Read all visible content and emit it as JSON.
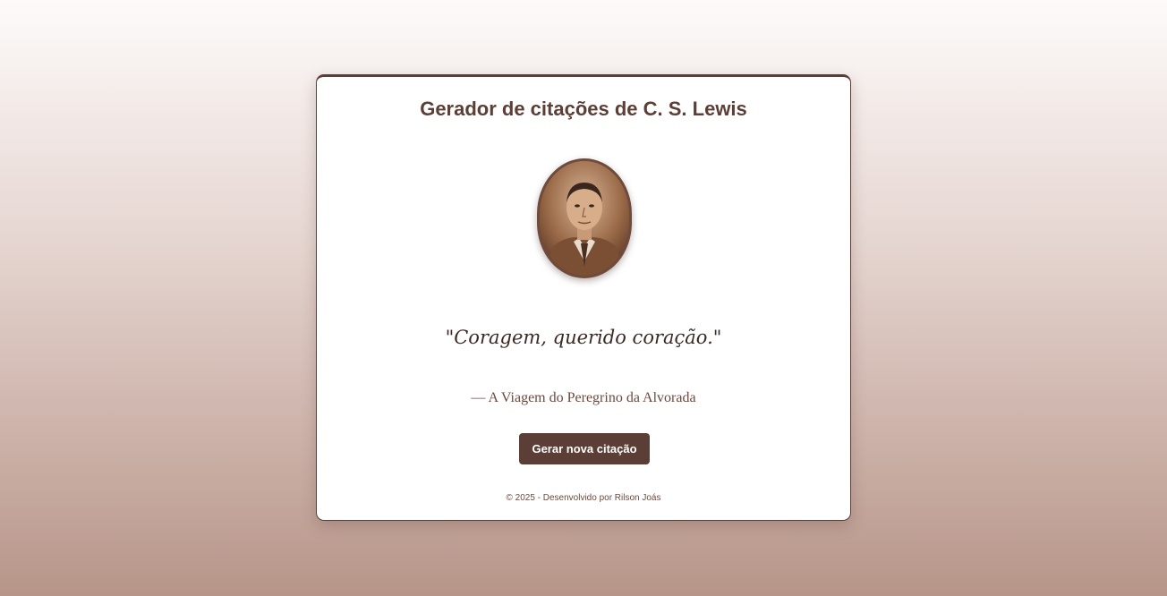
{
  "app": {
    "title": "Gerador de citações de C. S. Lewis"
  },
  "portrait": {
    "subject": "C. S. Lewis portrait"
  },
  "quote": {
    "text": "\"Coragem, querido coração.\"",
    "source": "— A Viagem do Peregrino da Alvorada"
  },
  "actions": {
    "generate_label": "Gerar nova citação"
  },
  "footer": {
    "text": "© 2025 - Desenvolvido por Rilson Joás"
  },
  "colors": {
    "accent": "#5b3f36",
    "card_background": "#ffffff",
    "text_primary": "#3b2a24",
    "text_secondary": "#6b4a3e"
  }
}
